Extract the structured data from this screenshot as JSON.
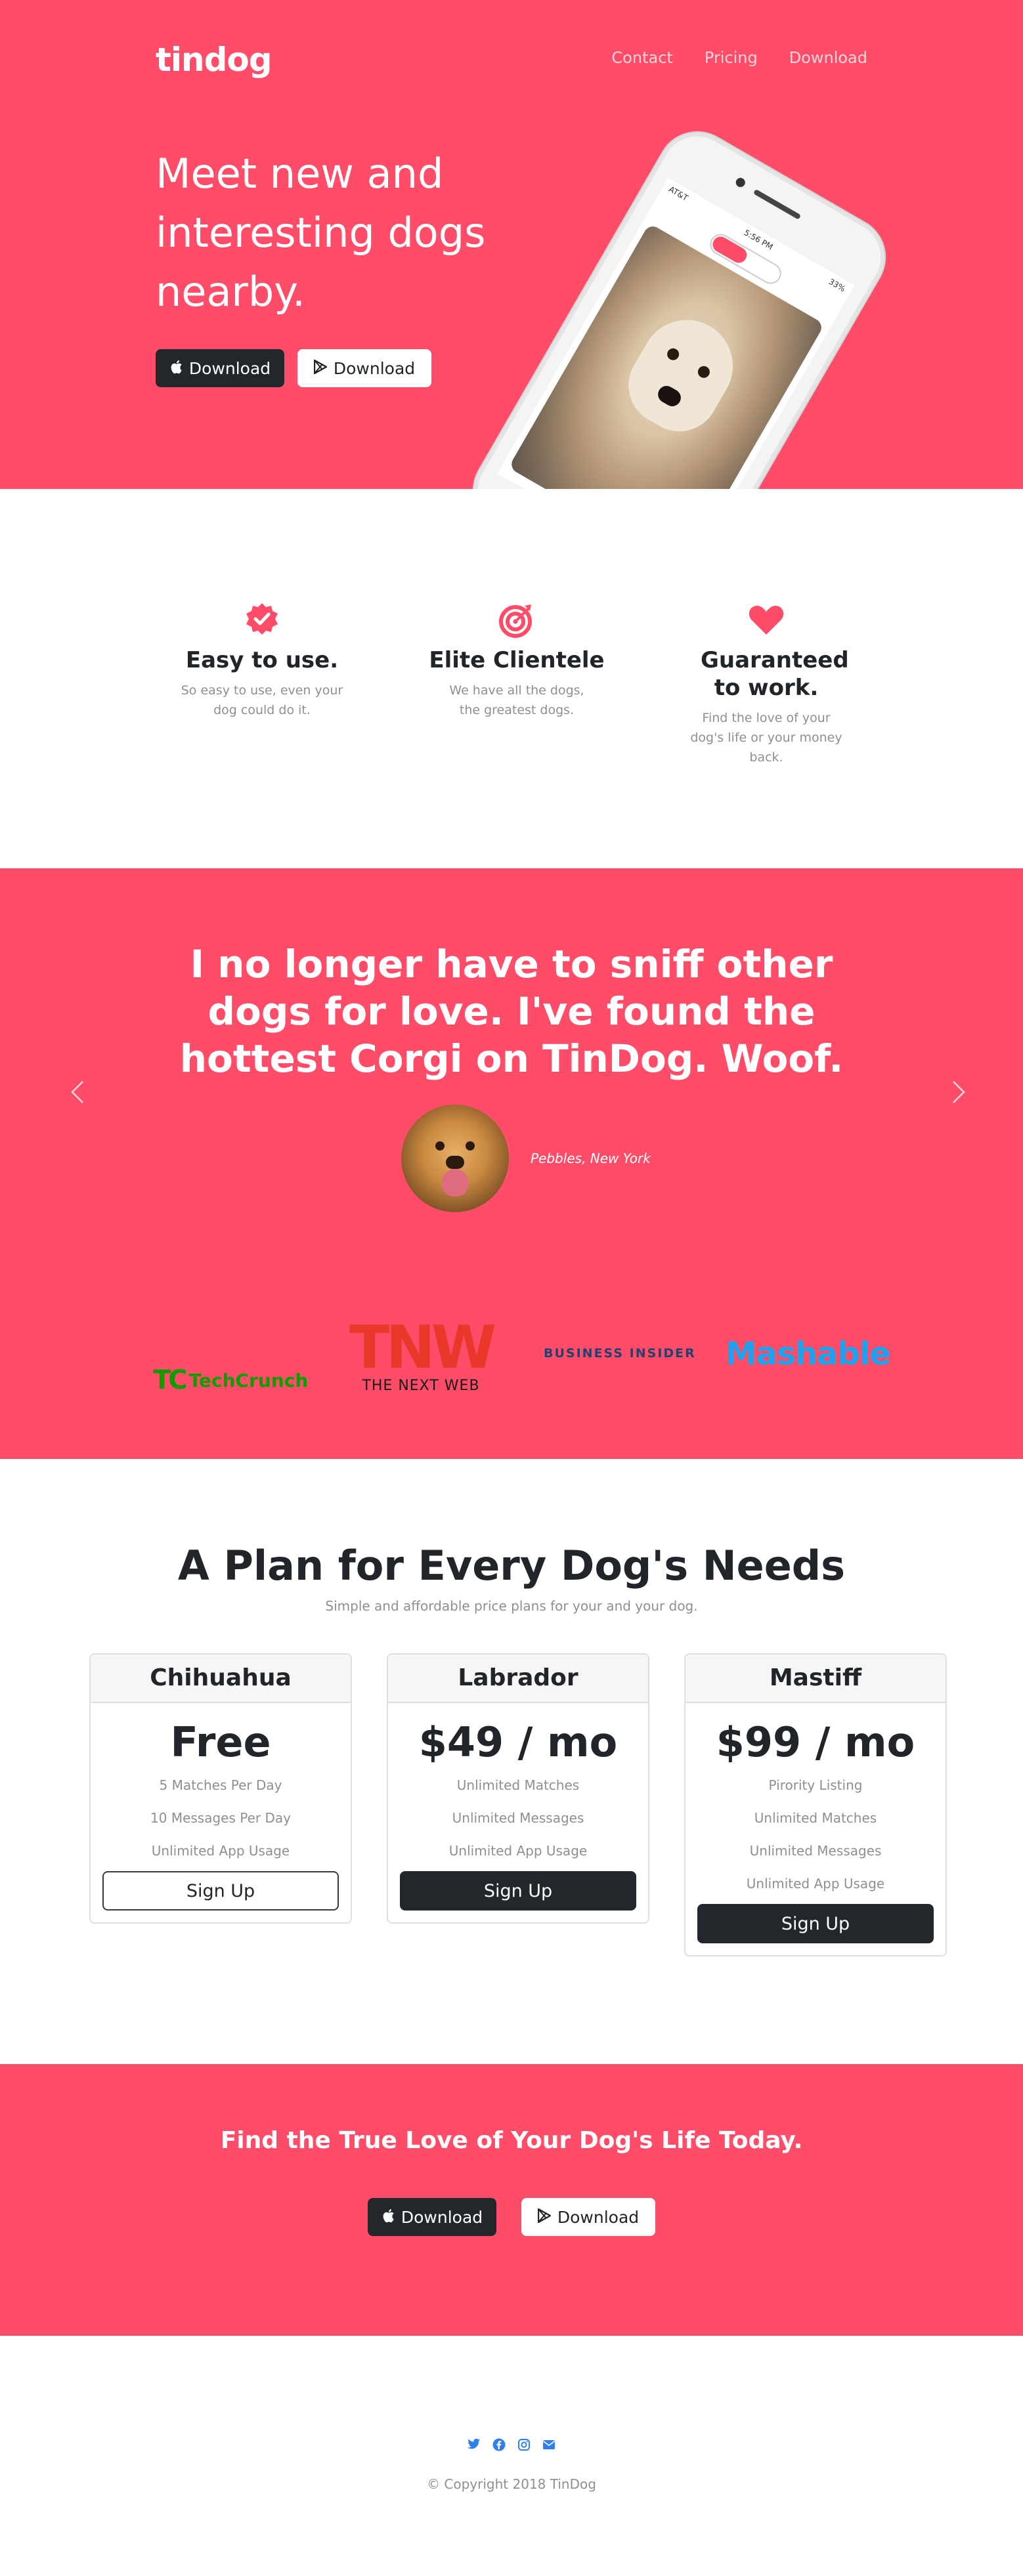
{
  "brand": "tindog",
  "nav": {
    "contact": "Contact",
    "pricing": "Pricing",
    "download": "Download"
  },
  "hero": {
    "title": "Meet new and interesting dogs nearby.",
    "download_apple": "Download",
    "download_google": "Download",
    "phone": {
      "carrier": "AT&T",
      "time": "5:56 PM",
      "battery": "33%"
    }
  },
  "features": [
    {
      "icon": "badge-check-icon",
      "title": "Easy to use.",
      "text": "So easy to use, even your dog could do it."
    },
    {
      "icon": "bullseye-icon",
      "title": "Elite Clientele",
      "text": "We have all the dogs, the greatest dogs."
    },
    {
      "icon": "heart-icon",
      "title": "Guaranteed to work.",
      "text": "Find the love of your dog's life or your money back."
    }
  ],
  "testimonial": {
    "quote": "I no longer have to sniff other dogs for love. I've found the hottest Corgi on TinDog. Woof.",
    "author": "Pebbles, New York"
  },
  "press": {
    "techcrunch_mark": "TC",
    "techcrunch": "TechCrunch",
    "tnw_mark": "TNW",
    "tnw": "THE NEXT WEB",
    "business_insider": "BUSINESS INSIDER",
    "mashable": "Mashable"
  },
  "pricing": {
    "title": "A Plan for Every Dog's Needs",
    "subtitle": "Simple and affordable price plans for your and your dog.",
    "plans": [
      {
        "name": "Chihuahua",
        "price": "Free",
        "features": [
          "5 Matches Per Day",
          "10 Messages Per Day",
          "Unlimited App Usage"
        ],
        "cta": "Sign Up"
      },
      {
        "name": "Labrador",
        "price": "$49 / mo",
        "features": [
          "Unlimited Matches",
          "Unlimited Messages",
          "Unlimited App Usage"
        ],
        "cta": "Sign Up"
      },
      {
        "name": "Mastiff",
        "price": "$99 / mo",
        "features": [
          "Pirority Listing",
          "Unlimited Matches",
          "Unlimited Messages",
          "Unlimited App Usage"
        ],
        "cta": "Sign Up"
      }
    ]
  },
  "cta": {
    "title": "Find the True Love of Your Dog's Life Today.",
    "download_apple": "Download",
    "download_google": "Download"
  },
  "footer": {
    "social_icons": [
      "twitter-icon",
      "facebook-icon",
      "instagram-icon",
      "envelope-icon"
    ],
    "copyright": "© Copyright 2018 TinDog"
  },
  "colors": {
    "brand_red": "#ff4c68",
    "dark_button": "#23272b",
    "link_blue": "#2f80ed"
  }
}
